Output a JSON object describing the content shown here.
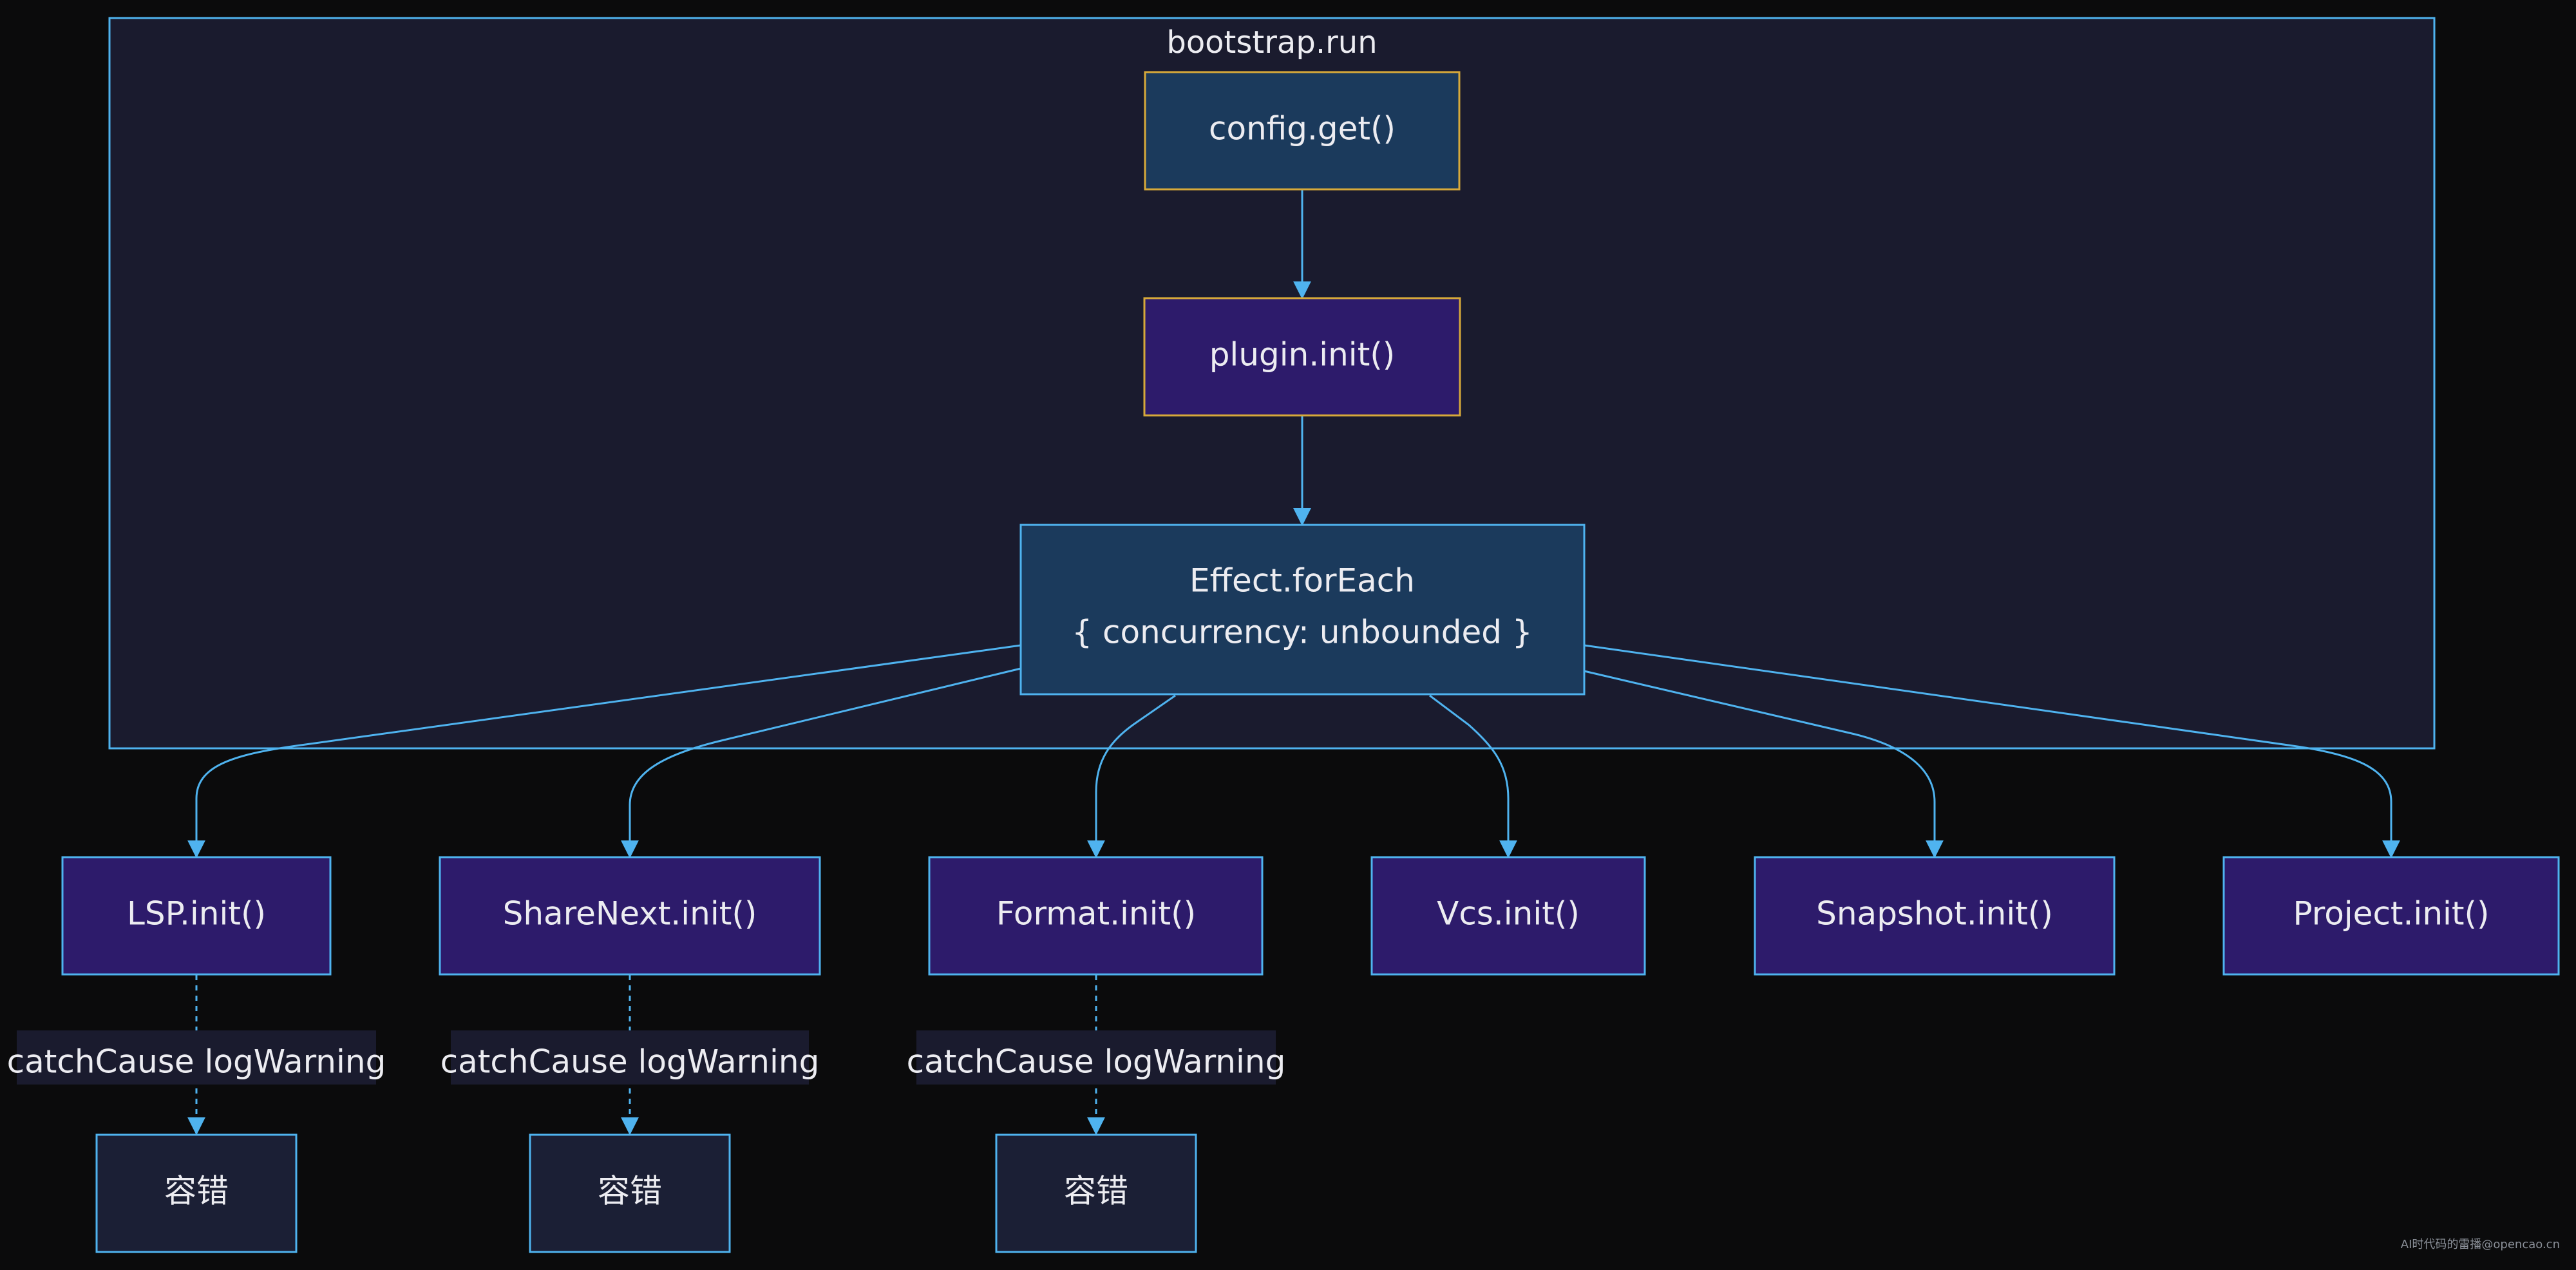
{
  "colors": {
    "background": "#0b0b0c",
    "cluster_fill": "#1a1b2e",
    "cluster_stroke": "#4fb3ef",
    "node_blue_fill": "#1b3a5c",
    "node_purple_fill": "#2d1b6b",
    "node_dark_fill": "#1b1f35",
    "stroke_gold": "#d7a93a",
    "stroke_blue": "#4fb3ef",
    "edge": "#4fb3ef",
    "label_bg": "#1a1b2e",
    "text": "#ececf1"
  },
  "cluster": {
    "title": "bootstrap.run"
  },
  "nodes": {
    "config_get": {
      "label": "config.get()"
    },
    "plugin_init": {
      "label": "plugin.init()"
    },
    "effect_foreach": {
      "line1": "Effect.forEach",
      "line2": "{ concurrency: unbounded }"
    },
    "lsp_init": {
      "label": "LSP.init()"
    },
    "sharenext_init": {
      "label": "ShareNext.init()"
    },
    "format_init": {
      "label": "Format.init()"
    },
    "vcs_init": {
      "label": "Vcs.init()"
    },
    "snapshot_init": {
      "label": "Snapshot.init()"
    },
    "project_init": {
      "label": "Project.init()"
    },
    "fault_tolerance_1": {
      "label": "容错"
    },
    "fault_tolerance_2": {
      "label": "容错"
    },
    "fault_tolerance_3": {
      "label": "容错"
    }
  },
  "edge_labels": {
    "lsp_catch": "catchCause logWarning",
    "sharenext_catch": "catchCause logWarning",
    "format_catch": "catchCause logWarning"
  },
  "watermark": {
    "text": "AI时代码的雷播@opencao.cn"
  }
}
